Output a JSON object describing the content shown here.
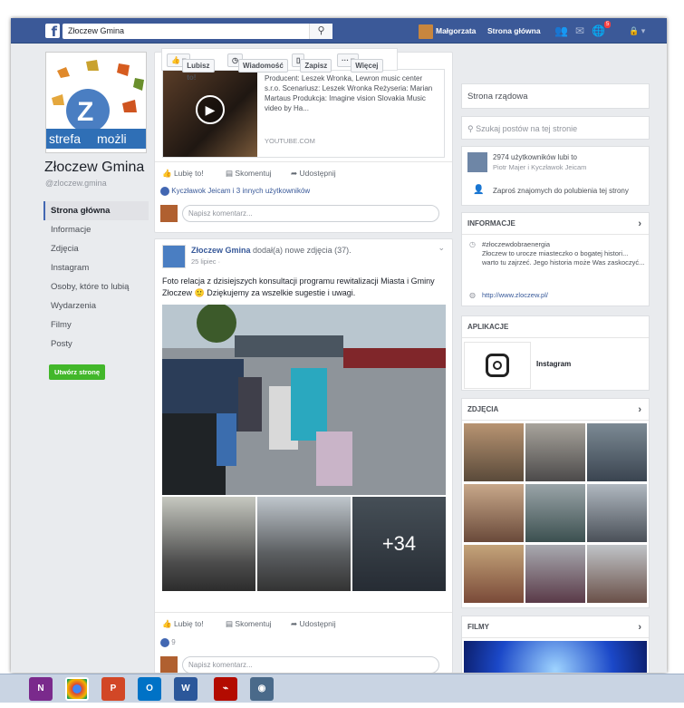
{
  "topbar": {
    "search_value": "Złoczew Gmina",
    "user_name": "Małgorzata",
    "home_label": "Strona główna",
    "notif_count": "5"
  },
  "page": {
    "name": "Złoczew Gmina",
    "handle": "@zloczew.gmina",
    "cover_text_1": "strefa",
    "cover_text_2": "możli"
  },
  "left_nav": [
    "Strona główna",
    "Informacje",
    "Zdjęcia",
    "Instagram",
    "Osoby, które to lubią",
    "Wydarzenia",
    "Filmy",
    "Posty"
  ],
  "create_page_label": "Utwórz stronę",
  "page_buttons": {
    "like": "Lubisz to!",
    "message": "Wiadomość",
    "save": "Zapisz",
    "more": "Więcej"
  },
  "post1": {
    "video_desc": "Producent: Leszek Wronka, Lewron music center s.r.o. Scenariusz: Leszek Wronka Reżyseria: Marian Martaus Produkcja: Imagine vision Slovakia Music video by Ha...",
    "video_source": "YOUTUBE.COM",
    "likes_text": "Kyczławok Jeicam i 3 innych użytkowników"
  },
  "actions": {
    "like": "Lubię to!",
    "comment": "Skomentuj",
    "share": "Udostępnij"
  },
  "comment_placeholder": "Napisz komentarz...",
  "post2": {
    "author": "Złoczew Gmina",
    "action": "dodał(a) nowe zdjęcia (37).",
    "date": "25 lipiec ·",
    "text": "Foto relacja z dzisiejszych konsultacji programu rewitalizacji Miasta i Gminy Złoczew 🙂 Dziękujemy za wszelkie sugestie i uwagi.",
    "more_photos": "+34",
    "like_count": "9"
  },
  "right": {
    "category": "Strona rządowa",
    "search_placeholder": "Szukaj postów na tej stronie",
    "likes_count": "2974 użytkowników lubi to",
    "likes_friends": "Piotr Majer i Kyczławok Jeicam",
    "invite": "Zaproś znajomych do polubienia tej strony",
    "info_title": "INFORMACJE",
    "info_hashtag": "#złoczewdobraenergia",
    "info_text": "Złoczew to urocze miasteczko o bogatej histori... warto tu zajrzeć. Jego historia może Was zaskoczyć...",
    "info_url": "http://www.zloczew.pl/",
    "apps_title": "APLIKACJE",
    "app_instagram": "Instagram",
    "photos_title": "ZDJĘCIA",
    "films_title": "FILMY"
  },
  "colors": {
    "fb_blue": "#3b5998",
    "bg": "#e9ebee",
    "green": "#42b72a"
  }
}
